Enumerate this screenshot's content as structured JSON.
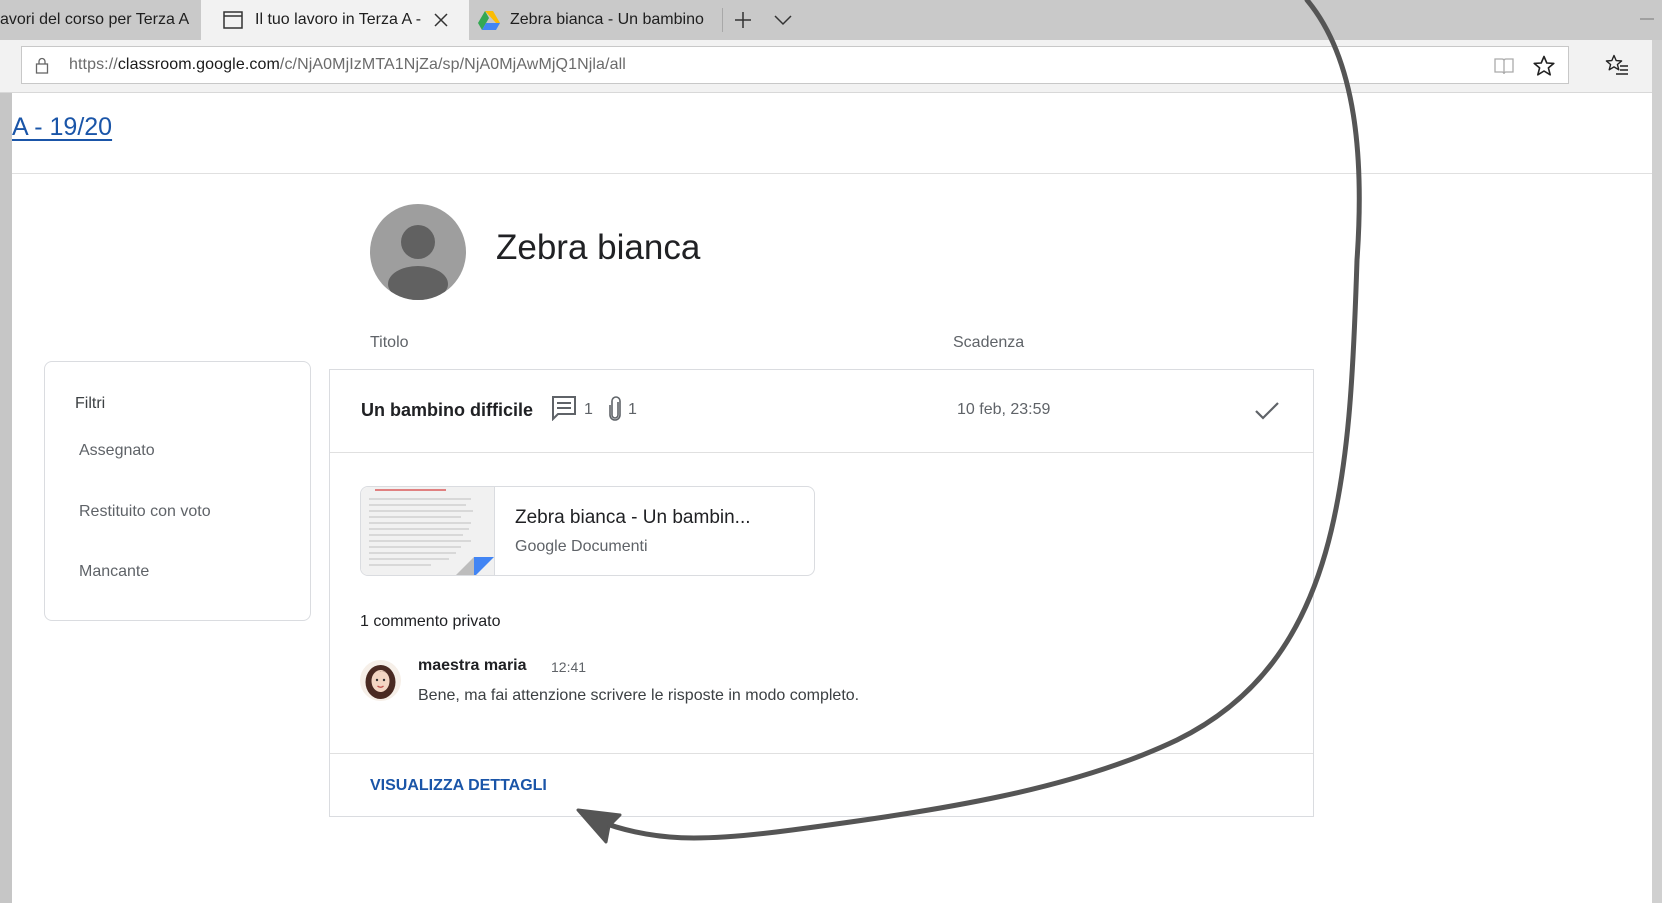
{
  "browser": {
    "tabs": [
      {
        "label": "avori del corso per Terza A",
        "active": false
      },
      {
        "label": "Il tuo lavoro in Terza A -",
        "active": true,
        "icon": "page-icon"
      },
      {
        "label": "Zebra bianca - Un bambino",
        "active": false,
        "icon": "google-drive-icon"
      }
    ],
    "url_scheme": "https://",
    "url_host": "classroom.google.com",
    "url_path": "/c/NjA0MjIzMTA1NjZa/sp/NjA0MjAwMjQ1Njla/all"
  },
  "page": {
    "class_link": "A - 19/20",
    "student_name": "Zebra bianca",
    "col_title": "Titolo",
    "col_due": "Scadenza"
  },
  "filters": {
    "heading": "Filtri",
    "items": [
      "Assegnato",
      "Restituito con voto",
      "Mancante"
    ]
  },
  "assignment": {
    "title": "Un bambino difficile",
    "comments_count": "1",
    "attachments_count": "1",
    "due": "10 feb, 23:59",
    "status": "completed",
    "attachment": {
      "title": "Zebra bianca - Un bambin...",
      "type": "Google Documenti"
    },
    "private_comments_heading": "1 commento privato",
    "comment": {
      "author": "maestra maria",
      "time": "12:41",
      "text": "Bene, ma fai attenzione scrivere le risposte in modo completo."
    },
    "details_link": "VISUALIZZA DETTAGLI"
  },
  "colors": {
    "link_blue": "#1a55a8",
    "annotation_arrow": "#555555",
    "doc_blue": "#4285f4"
  }
}
